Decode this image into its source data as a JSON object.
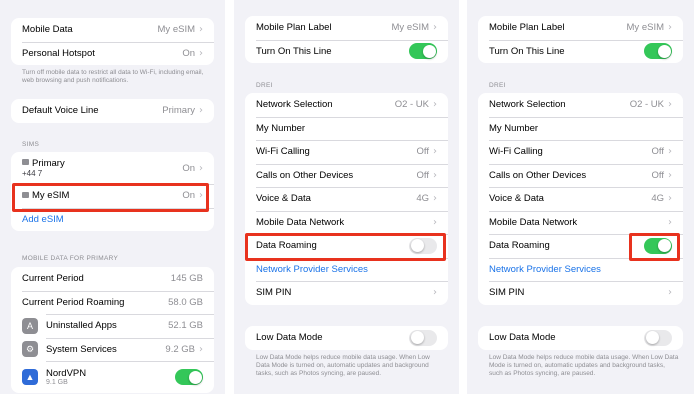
{
  "panel1": {
    "group_top": {
      "mobile_data": {
        "label": "Mobile Data",
        "value": "My eSIM"
      },
      "hotspot": {
        "label": "Personal Hotspot",
        "value": "On"
      }
    },
    "caption": "Turn off mobile data to restrict all data to Wi-Fi, including email, web browsing and push notifications.",
    "default_voice": {
      "label": "Default Voice Line",
      "value": "Primary"
    },
    "sims_header": "SIMs",
    "primary": {
      "label": "Primary",
      "sub": "+44 7",
      "value": "On"
    },
    "esim": {
      "label": "My eSIM",
      "value": "On"
    },
    "add_esim": "Add eSIM",
    "usage_header": "MOBILE DATA FOR PRIMARY",
    "usage": [
      {
        "label": "Current Period",
        "value": "145 GB"
      },
      {
        "label": "Current Period Roaming",
        "value": "58.0 GB"
      }
    ],
    "apps": [
      {
        "label": "Uninstalled Apps",
        "value": "52.1 GB",
        "icon": "app-store-icon"
      },
      {
        "label": "System Services",
        "value": "9.2 GB",
        "icon": "gear-icon"
      },
      {
        "label": "NordVPN",
        "sub": "9.1 GB",
        "icon": "nordvpn-icon",
        "toggle": true
      }
    ]
  },
  "panel2": {
    "plan_label": {
      "label": "Mobile Plan Label",
      "value": "My eSIM"
    },
    "turn_on": {
      "label": "Turn On This Line",
      "toggle": true
    },
    "carrier_header": "DREI",
    "rows": [
      {
        "label": "Network Selection",
        "value": "O2 - UK"
      },
      {
        "label": "My Number",
        "value": ""
      },
      {
        "label": "Wi-Fi Calling",
        "value": "Off"
      },
      {
        "label": "Calls on Other Devices",
        "value": "Off"
      },
      {
        "label": "Voice & Data",
        "value": "4G"
      },
      {
        "label": "Mobile Data Network",
        "value": ""
      }
    ],
    "data_roaming": {
      "label": "Data Roaming",
      "toggle": false
    },
    "provider_services": "Network Provider Services",
    "sim_pin": {
      "label": "SIM PIN"
    },
    "low_data": {
      "label": "Low Data Mode",
      "toggle": false
    },
    "low_data_caption": "Low Data Mode helps reduce mobile data usage. When Low Data Mode is turned on, automatic updates and background tasks, such as Photos syncing, are paused."
  },
  "panel3": {
    "plan_label": {
      "label": "Mobile Plan Label",
      "value": "My eSIM"
    },
    "turn_on": {
      "label": "Turn On This Line",
      "toggle": true
    },
    "carrier_header": "DREI",
    "rows": [
      {
        "label": "Network Selection",
        "value": "O2 - UK"
      },
      {
        "label": "My Number",
        "value": ""
      },
      {
        "label": "Wi-Fi Calling",
        "value": "Off"
      },
      {
        "label": "Calls on Other Devices",
        "value": "Off"
      },
      {
        "label": "Voice & Data",
        "value": "4G"
      },
      {
        "label": "Mobile Data Network",
        "value": ""
      }
    ],
    "data_roaming": {
      "label": "Data Roaming",
      "toggle": true
    },
    "provider_services": "Network Provider Services",
    "sim_pin": {
      "label": "SIM PIN"
    },
    "low_data": {
      "label": "Low Data Mode",
      "toggle": false
    },
    "low_data_caption": "Low Data Mode helps reduce mobile data usage. When Low Data Mode is turned on, automatic updates and background tasks, such as Photos syncing, are paused."
  },
  "colors": {
    "accent": "#1a73e8",
    "toggle_on": "#34c759",
    "highlight": "#e8321e"
  }
}
